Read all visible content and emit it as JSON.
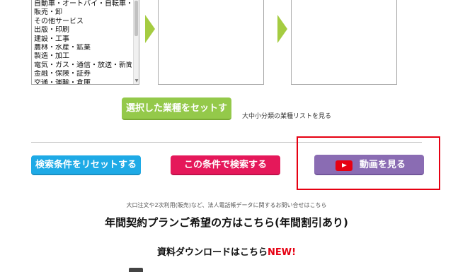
{
  "industry_list": {
    "items": [
      "自動車・オートバイ・自転車・ドライブ",
      "販売・卸",
      "その他サービス",
      "出版・印刷",
      "建設・工事",
      "農林・水産・鉱業",
      "製造・加工",
      "電気・ガス・通信・放送・新聞",
      "金融・保険・証券",
      "交通・運輸・倉庫"
    ]
  },
  "buttons": {
    "set_industry": "選択した業種をセットする",
    "reset_conditions": "検索条件をリセットする",
    "search": "この条件で検索する",
    "watch_video": "動画を見る"
  },
  "links": {
    "industry_list": "大中小分類の業種リストを見る"
  },
  "info": {
    "inquiry_note": "大口注文や2次利用(販売)など、法人電話帳データに関するお問い合せはこちら",
    "annual_plan": "年間契約プランご希望の方はこちら(年間割引あり)",
    "download": "資料ダウンロードはこちら",
    "new_badge": "NEW!"
  },
  "colors": {
    "set_button": "#94c94a",
    "reset_button": "#1eaae6",
    "search_button": "#e5185a",
    "video_button": "#8a6cb3",
    "highlight_border": "#e60012",
    "arrow": "#a5cc41"
  },
  "icons": [
    "chevron-right-icon",
    "youtube-play-icon",
    "scroll-up-icon",
    "scroll-down-icon"
  ]
}
